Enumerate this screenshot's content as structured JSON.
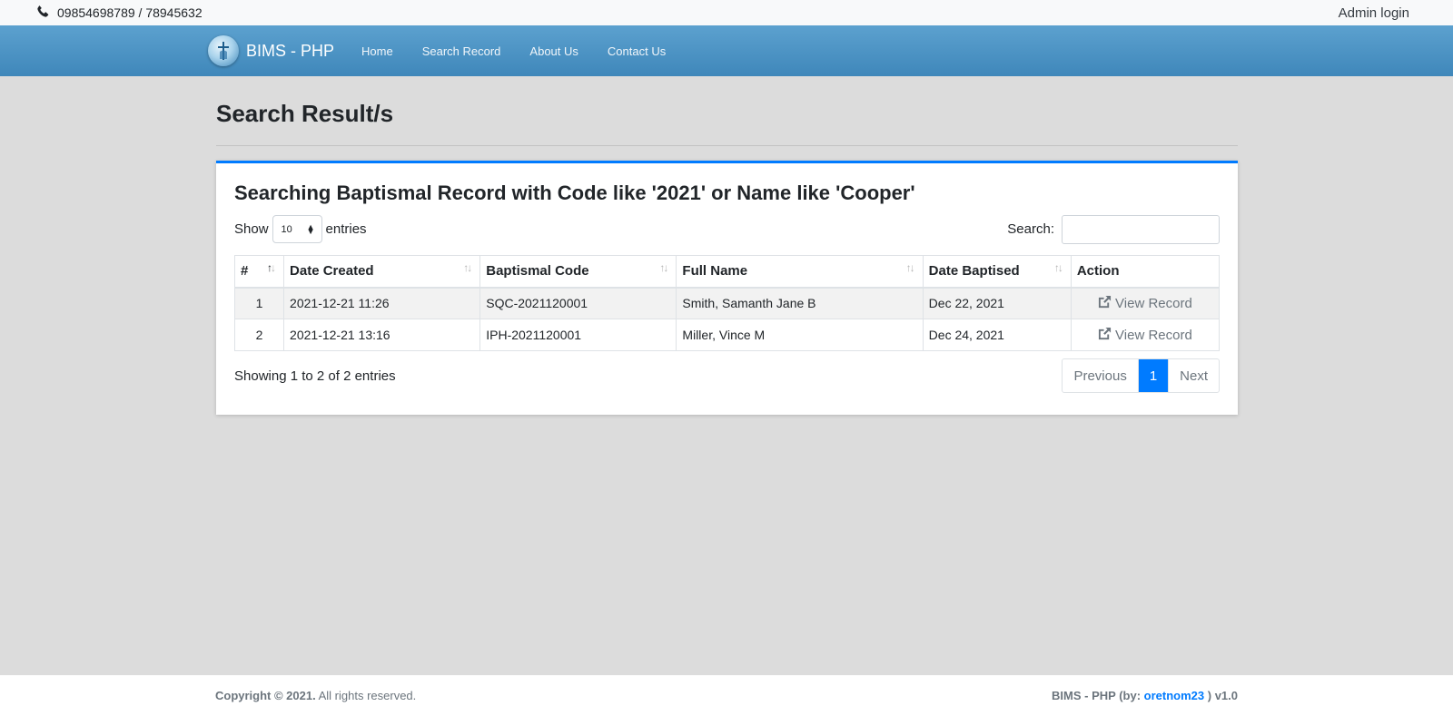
{
  "topbar": {
    "phone": "09854698789 / 78945632",
    "admin_link": "Admin login"
  },
  "navbar": {
    "brand": "BIMS - PHP",
    "links": [
      "Home",
      "Search Record",
      "About Us",
      "Contact Us"
    ]
  },
  "page": {
    "title": "Search Result/s"
  },
  "card": {
    "title": "Searching Baptismal Record with Code like '2021' or Name like 'Cooper'",
    "show_label": "Show",
    "entries_value": "10",
    "entries_label": "entries",
    "search_label": "Search:",
    "search_value": ""
  },
  "table": {
    "columns": [
      "#",
      "Date Created",
      "Baptismal Code",
      "Full Name",
      "Date Baptised",
      "Action"
    ],
    "rows": [
      {
        "num": "1",
        "date_created": "2021-12-21 11:26",
        "code": "SQC-2021120001",
        "full_name": "Smith, Samanth Jane B",
        "date_baptised": "Dec 22, 2021",
        "action": "View Record"
      },
      {
        "num": "2",
        "date_created": "2021-12-21 13:16",
        "code": "IPH-2021120001",
        "full_name": "Miller, Vince M",
        "date_baptised": "Dec 24, 2021",
        "action": "View Record"
      }
    ],
    "info": "Showing 1 to 2 of 2 entries",
    "pagination": {
      "previous": "Previous",
      "current": "1",
      "next": "Next"
    }
  },
  "footer": {
    "copyright_bold": "Copyright © 2021.",
    "copyright_rest": "All rights reserved.",
    "credit_prefix": "BIMS - PHP (by:",
    "author": "oretnom23",
    "credit_suffix": ") v1.0"
  },
  "colors": {
    "navbar": "#4a93c4",
    "accent": "#007bff",
    "background": "#dcdcdc"
  }
}
